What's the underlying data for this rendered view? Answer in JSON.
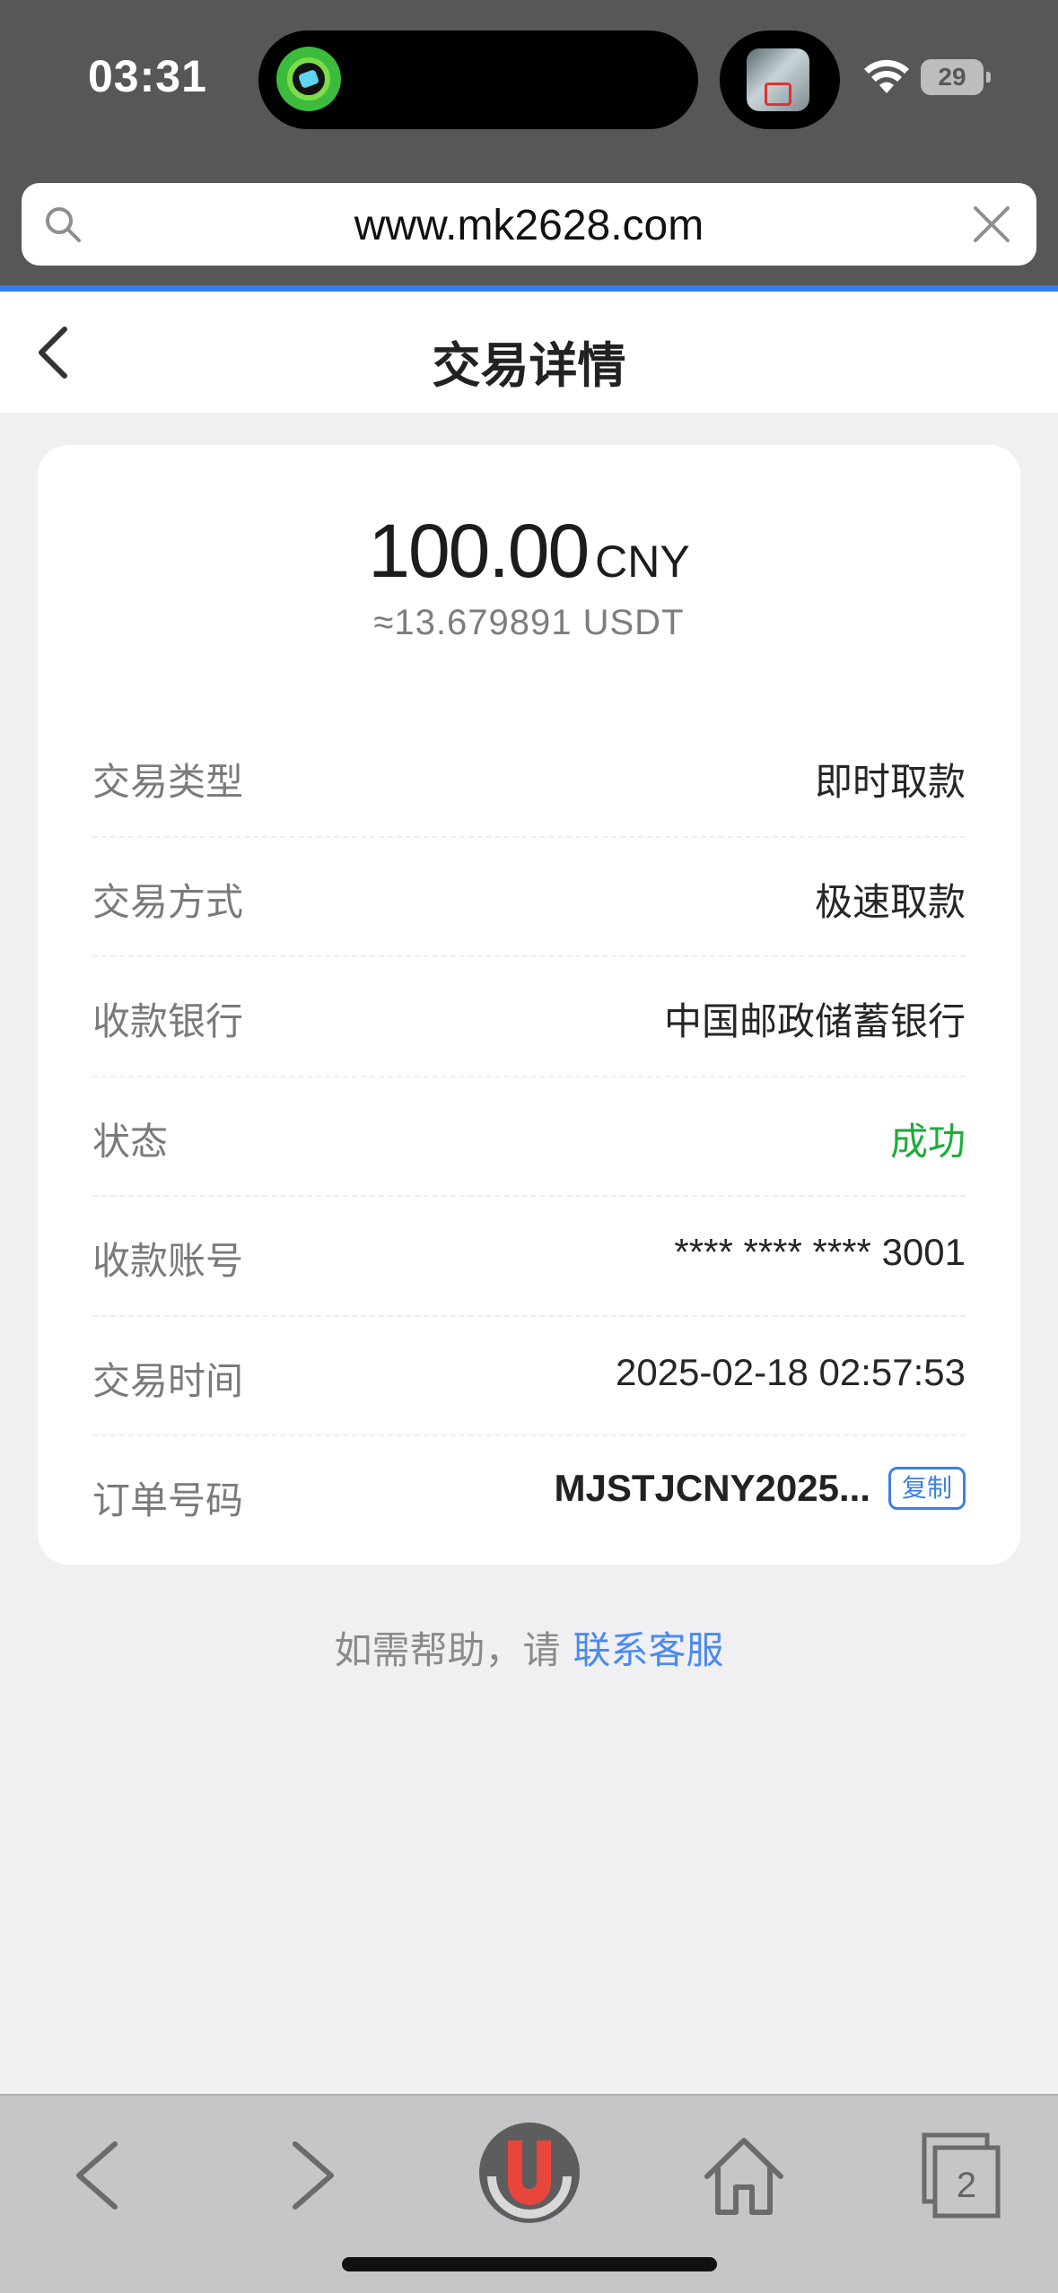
{
  "status_bar": {
    "time": "03:31",
    "battery": "29"
  },
  "browser": {
    "url": "www.mk2628.com",
    "tab_count": "2"
  },
  "page": {
    "title": "交易详情"
  },
  "amount": {
    "value": "100.00",
    "currency": "CNY",
    "usdt_equivalent": "≈13.679891  USDT"
  },
  "details": [
    {
      "label": "交易类型",
      "value": "即时取款"
    },
    {
      "label": "交易方式",
      "value": "极速取款"
    },
    {
      "label": "收款银行",
      "value": "中国邮政储蓄银行"
    },
    {
      "label": "状态",
      "value": "成功",
      "status_color": "#1fac3c"
    },
    {
      "label": "收款账号",
      "value": "****  ****  ****  3001"
    },
    {
      "label": "交易时间",
      "value": "2025-02-18 02:57:53"
    },
    {
      "label": "订单号码",
      "value": "MJSTJCNY2025...",
      "action": "复制"
    }
  ],
  "help": {
    "prefix": "如需帮助，请",
    "link": "联系客服"
  },
  "colors": {
    "accent_blue": "#2f7ef2",
    "success_green": "#1fac3c",
    "link_blue": "#4c8af0"
  }
}
